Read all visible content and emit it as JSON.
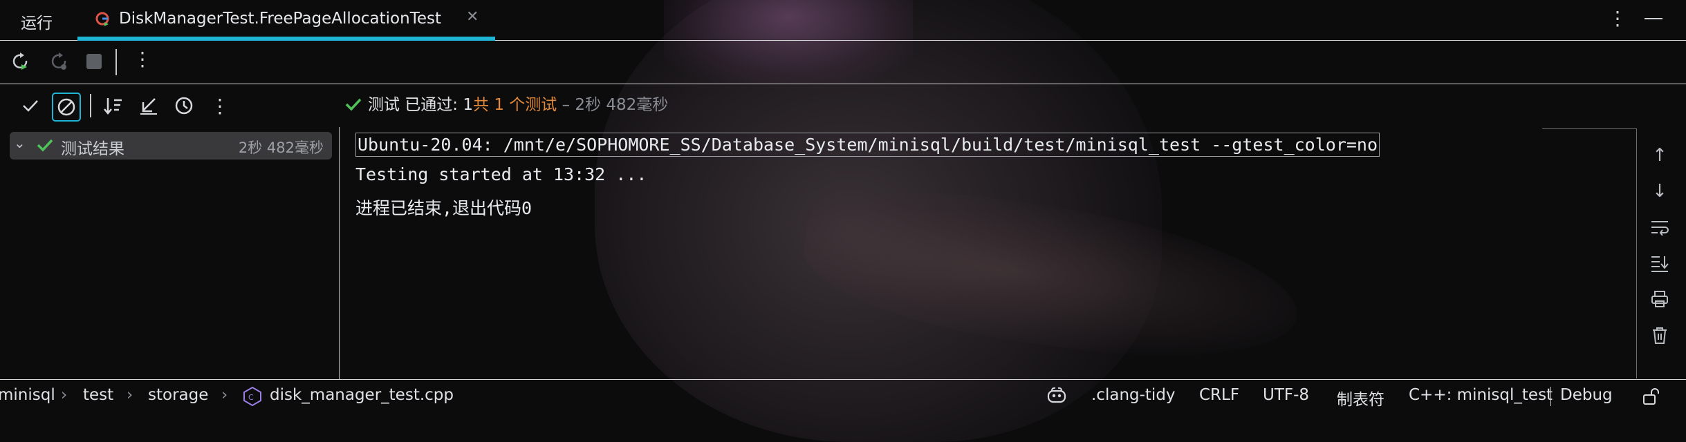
{
  "tabs": {
    "run_label": "运行",
    "active_title": "DiskManagerTest.FreePageAllocationTest"
  },
  "test_tree": {
    "root_label": "测试结果",
    "root_time": "2秒 482毫秒"
  },
  "status": {
    "passed_text": "测试 已通过: 1",
    "total_text": "共 1 个测试",
    "duration_text": "– 2秒 482毫秒"
  },
  "console": {
    "lines": [
      "Ubuntu-20.04: /mnt/e/SOPHOMORE_SS/Database_System/minisql/build/test/minisql_test --gtest_color=no",
      "Testing started at 13:32 ...",
      "进程已结束,退出代码0"
    ]
  },
  "breadcrumb": {
    "items": [
      "minisql",
      "test",
      "storage",
      "disk_manager_test.cpp"
    ]
  },
  "statusbar": {
    "clang_tidy": ".clang-tidy",
    "line_ending": "CRLF",
    "encoding": "UTF-8",
    "indent": "制表符",
    "context": "C++: minisql_test",
    "config": "Debug"
  },
  "colors": {
    "accent": "#1fb6d6",
    "pass": "#4fc35a",
    "total": "#e0893a"
  },
  "icons": {
    "tab_icon": "gtest-run-icon",
    "rerun": "rerun-icon",
    "rerun_failed": "rerun-failed-icon",
    "stop": "stop-icon",
    "show_passed": "checkmark-icon",
    "show_ignored": "ignored-icon",
    "sort": "sort-icon",
    "collapse": "collapse-icon",
    "history": "history-icon",
    "file": "cpp-file-icon",
    "copilot": "copilot-icon",
    "lock": "lock-icon"
  }
}
